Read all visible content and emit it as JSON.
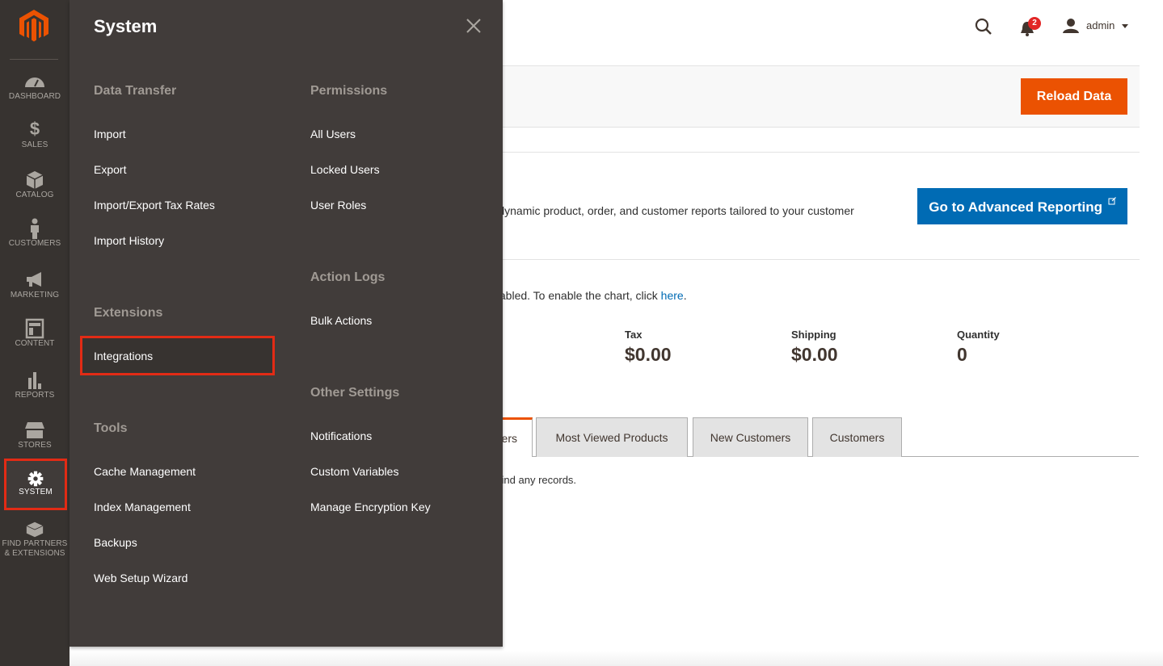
{
  "sidebar": {
    "items": [
      {
        "label": "DASHBOARD",
        "icon": "dashboard-icon"
      },
      {
        "label": "SALES",
        "icon": "dollar-icon"
      },
      {
        "label": "CATALOG",
        "icon": "box-icon"
      },
      {
        "label": "CUSTOMERS",
        "icon": "person-icon"
      },
      {
        "label": "MARKETING",
        "icon": "megaphone-icon"
      },
      {
        "label": "CONTENT",
        "icon": "layout-icon"
      },
      {
        "label": "REPORTS",
        "icon": "bar-chart-icon"
      },
      {
        "label": "STORES",
        "icon": "storefront-icon"
      },
      {
        "label": "SYSTEM",
        "icon": "gear-icon",
        "active": true
      },
      {
        "label": "FIND PARTNERS & EXTENSIONS",
        "icon": "blocks-icon"
      }
    ]
  },
  "flyout": {
    "title": "System",
    "groups": {
      "data_transfer": {
        "title": "Data Transfer",
        "items": [
          "Import",
          "Export",
          "Import/Export Tax Rates",
          "Import History"
        ]
      },
      "extensions": {
        "title": "Extensions",
        "items": [
          "Integrations"
        ]
      },
      "tools": {
        "title": "Tools",
        "items": [
          "Cache Management",
          "Index Management",
          "Backups",
          "Web Setup Wizard"
        ]
      },
      "permissions": {
        "title": "Permissions",
        "items": [
          "All Users",
          "Locked Users",
          "User Roles"
        ]
      },
      "action_logs": {
        "title": "Action Logs",
        "items": [
          "Bulk Actions"
        ]
      },
      "other_settings": {
        "title": "Other Settings",
        "items": [
          "Notifications",
          "Custom Variables",
          "Manage Encryption Key"
        ]
      }
    }
  },
  "header": {
    "notification_count": "2",
    "user": "admin"
  },
  "actions": {
    "reload": "Reload Data"
  },
  "advanced_reporting": {
    "text": "ur dynamic product, order, and customer reports tailored to your customer",
    "button": "Go to Advanced Reporting"
  },
  "chart_notice": {
    "text": "disabled. To enable the chart, click ",
    "link": "here",
    "tail": "."
  },
  "stats": [
    {
      "label": "Tax",
      "value": "$0.00"
    },
    {
      "label": "Shipping",
      "value": "$0.00"
    },
    {
      "label": "Quantity",
      "value": "0"
    }
  ],
  "tabs": [
    {
      "label": "ers",
      "active": true
    },
    {
      "label": "Most Viewed Products"
    },
    {
      "label": "New Customers"
    },
    {
      "label": "Customers"
    }
  ],
  "no_records": "n't find any records.",
  "colors": {
    "accent": "#eb5202",
    "link": "#006bb4",
    "sidebar": "#373330",
    "flyout": "#413c3a",
    "highlight": "#e22b15"
  }
}
